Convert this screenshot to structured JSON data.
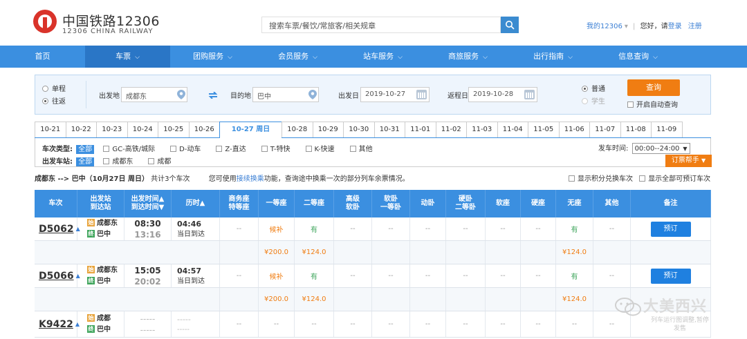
{
  "header": {
    "logo_cn": "中国铁路12306",
    "logo_en": "12306 CHINA RAILWAY",
    "search_placeholder": "搜索车票/餐饮/常旅客/相关规章",
    "my12306": "我的12306",
    "greeting": "您好，请",
    "login": "登录",
    "register": "注册"
  },
  "nav": [
    {
      "label": "首页",
      "dropdown": false
    },
    {
      "label": "车票",
      "dropdown": true,
      "active": true
    },
    {
      "label": "团购服务",
      "dropdown": true
    },
    {
      "label": "会员服务",
      "dropdown": true
    },
    {
      "label": "站车服务",
      "dropdown": true
    },
    {
      "label": "商旅服务",
      "dropdown": true
    },
    {
      "label": "出行指南",
      "dropdown": true
    },
    {
      "label": "信息查询",
      "dropdown": true
    }
  ],
  "query": {
    "trip_single": "单程",
    "trip_round": "往返",
    "from_label": "出发地",
    "from_value": "成都东",
    "to_label": "目的地",
    "to_value": "巴中",
    "depart_label": "出发日",
    "depart_value": "2019-10-27",
    "return_label": "返程日",
    "return_value": "2019-10-28",
    "type_normal": "普通",
    "type_student": "学生",
    "query_btn": "查询",
    "auto_query": "开启自动查询"
  },
  "dates": [
    "10-21",
    "10-22",
    "10-23",
    "10-24",
    "10-25",
    "10-26",
    "10-27 周日",
    "10-28",
    "10-29",
    "10-30",
    "10-31",
    "11-01",
    "11-02",
    "11-03",
    "11-04",
    "11-05",
    "11-06",
    "11-07",
    "11-08",
    "11-09"
  ],
  "selected_date_index": 6,
  "filters": {
    "type_label": "车次类型:",
    "all": "全部",
    "types": [
      "GC-高铁/城际",
      "D-动车",
      "Z-直达",
      "T-特快",
      "K-快速",
      "其他"
    ],
    "station_label": "出发车站:",
    "stations": [
      "成都东",
      "成都"
    ],
    "depart_time_label": "发车时间:",
    "depart_time_value": "00:00--24:00",
    "helper": "订票帮手"
  },
  "summary": {
    "route": "成都东 --> 巴中（10月27日  周日）",
    "count": "共计3个车次",
    "tip_pre": "您可使用",
    "tip_link": "接续换乘",
    "tip_post": "功能，查询途中换乘一次的部分列车余票情况。",
    "opt1": "显示积分兑换车次",
    "opt2": "显示全部可预订车次"
  },
  "table": {
    "headers": [
      "车次",
      "出发站\n到达站",
      "出发时间▲\n到达时间▼",
      "历时▲",
      "商务座\n特等座",
      "一等座",
      "二等座",
      "高级\n软卧",
      "软卧\n一等卧",
      "动卧",
      "硬卧\n二等卧",
      "软座",
      "硬座",
      "无座",
      "其他",
      "备注"
    ],
    "rows": [
      {
        "train": "D5062",
        "from": "成都东",
        "to": "巴中",
        "dep": "08:30",
        "arr": "13:16",
        "dur": "04:46",
        "arrive_note": "当日到达",
        "seats": [
          "--",
          "候补",
          "有",
          "--",
          "--",
          "--",
          "--",
          "--",
          "--",
          "有",
          "--"
        ],
        "prices": [
          "",
          "¥200.0",
          "¥124.0",
          "",
          "",
          "",
          "",
          "",
          "",
          "¥124.0",
          ""
        ],
        "book": "预订"
      },
      {
        "train": "D5066",
        "from": "成都东",
        "to": "巴中",
        "dep": "15:05",
        "arr": "20:02",
        "dur": "04:57",
        "arrive_note": "当日到达",
        "seats": [
          "--",
          "候补",
          "有",
          "--",
          "--",
          "--",
          "--",
          "--",
          "--",
          "有",
          "--"
        ],
        "prices": [
          "",
          "¥200.0",
          "¥124.0",
          "",
          "",
          "",
          "",
          "",
          "",
          "¥124.0",
          ""
        ],
        "book": "预订"
      },
      {
        "train": "K9422",
        "from": "成都",
        "to": "巴中",
        "dep": "-----",
        "arr": "-----",
        "dur": "-----",
        "arrive_note": "-----",
        "seats": [
          "--",
          "--",
          "--",
          "--",
          "--",
          "--",
          "--",
          "--",
          "--",
          "--",
          "--"
        ],
        "book": ""
      }
    ]
  },
  "tags": {
    "start": "始",
    "end": "终"
  },
  "watermark": {
    "title": "大美西兴",
    "sub": "列车运行图调整,暂停发售"
  }
}
